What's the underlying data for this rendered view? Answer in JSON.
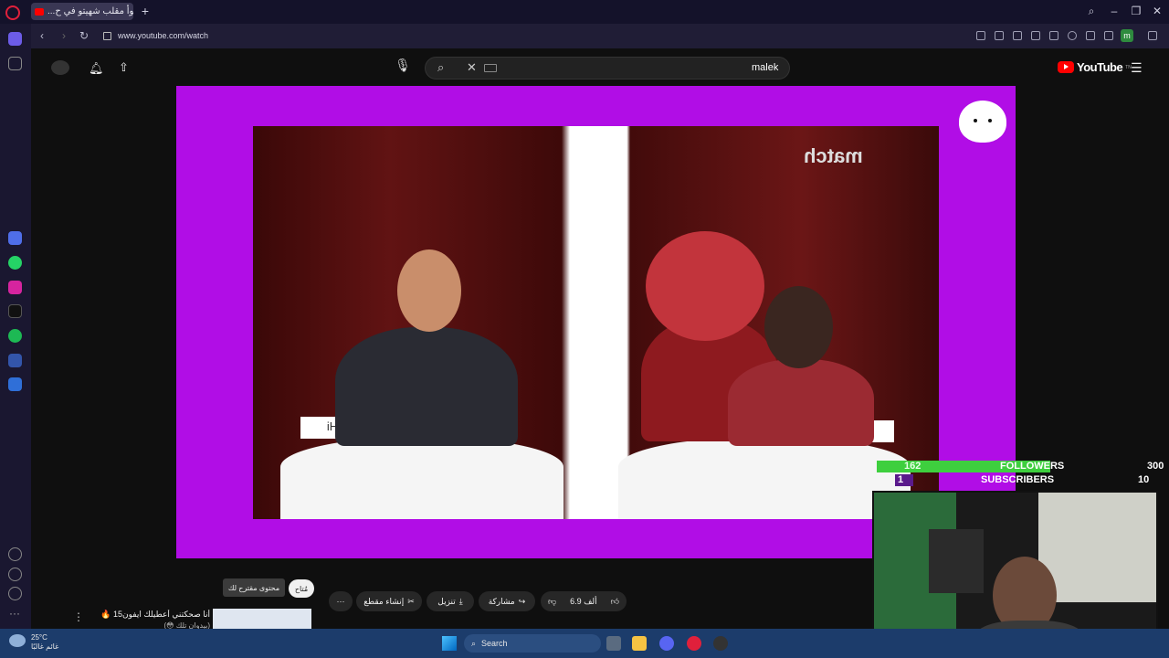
{
  "browser": {
    "tab_title": "أسوأ مقلب شهيتو في ح...",
    "url": "www.youtube.com/watch",
    "profile_letter": "m"
  },
  "youtube": {
    "search_text": "malek",
    "logo_text": "YouTube",
    "logo_sup": "TN"
  },
  "video": {
    "brand_watermark": "match",
    "sign_left": "iH",
    "sign_right": "iH"
  },
  "stats": {
    "followers_label": "FOLLOWERS",
    "followers_current": "162",
    "followers_goal": "300",
    "subscribers_label": "SUBSCRIBERS",
    "subscribers_current": "1",
    "subscribers_goal": "10"
  },
  "actions": {
    "like_count": "6.9 ألف",
    "share_label": "مشاركة",
    "download_label": "تنزيل",
    "clip_label": "إنشاء مقطع",
    "tooltip": "محتوى مقترح لك",
    "chip": "مُتاح"
  },
  "recommend": {
    "title": "أنا صحكتني أعطيلك ايفون15 🔥",
    "subtitle": "(بيدوان تلك 😳)"
  },
  "taskbar": {
    "search_label": "Search",
    "temp": "25°C",
    "weather": "غائم غالبًا"
  }
}
